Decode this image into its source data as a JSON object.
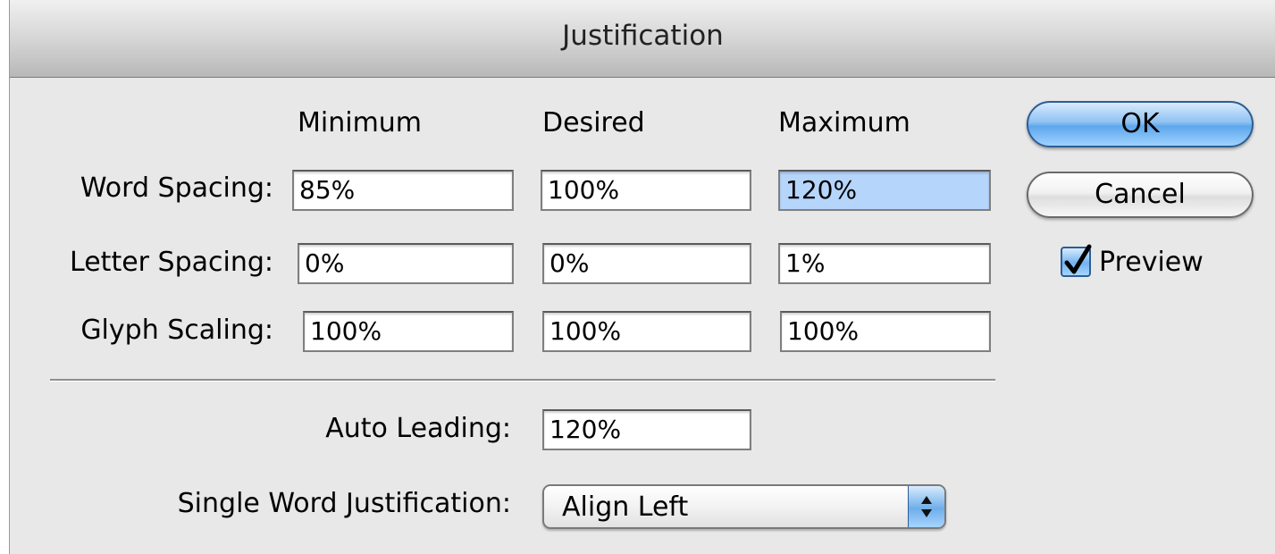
{
  "window": {
    "title": "Justification"
  },
  "columns": {
    "minimum": "Minimum",
    "desired": "Desired",
    "maximum": "Maximum"
  },
  "rows": [
    {
      "label": "Word Spacing:",
      "minimum": "85%",
      "desired": "100%",
      "maximum": "120%"
    },
    {
      "label": "Letter Spacing:",
      "minimum": "0%",
      "desired": "0%",
      "maximum": "1%"
    },
    {
      "label": "Glyph Scaling:",
      "minimum": "100%",
      "desired": "100%",
      "maximum": "100%"
    }
  ],
  "auto_leading": {
    "label": "Auto Leading:",
    "value": "120%"
  },
  "single_word": {
    "label": "Single Word Justification:",
    "selected": "Align Left"
  },
  "buttons": {
    "ok": "OK",
    "cancel": "Cancel"
  },
  "preview": {
    "label": "Preview",
    "checked": true
  },
  "icons": {
    "checkbox": "checkmark-icon",
    "popup": "up-down-arrows-icon"
  },
  "colors": {
    "selection": "#b6d5fb",
    "accent": "#5ea7ec"
  }
}
